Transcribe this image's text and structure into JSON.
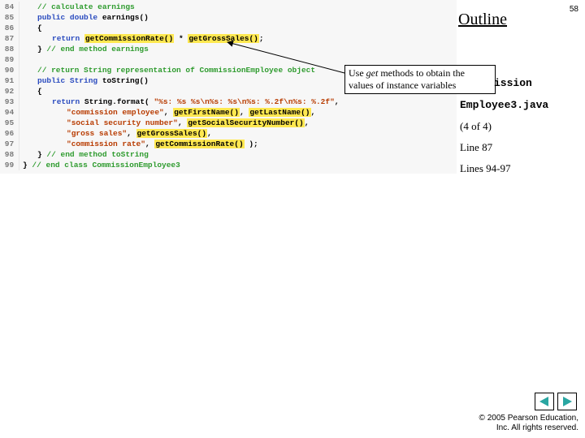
{
  "slide_number": "58",
  "outline_heading": "Outline",
  "callout": {
    "line1_a": "Use ",
    "line1_b_italic": "get",
    "line1_c": " methods to obtain the",
    "line2": "values of instance variables"
  },
  "side": {
    "commission_frag": "ission",
    "employee3": "Employee3.java",
    "page_count": "(4 of 4)",
    "line87": "Line 87",
    "lines9497": "Lines 94-97"
  },
  "footer": {
    "line1": "© 2005 Pearson Education,",
    "line2": "Inc.  All rights reserved."
  },
  "code": {
    "l84": {
      "n": "84",
      "comment": "// calculate earnings"
    },
    "l85": {
      "n": "85",
      "kw1": "public",
      "kw2": "double",
      "name": " earnings()"
    },
    "l86": {
      "n": "86",
      "brace": "{"
    },
    "l87": {
      "n": "87",
      "kw": "return",
      "call1": "getCommissionRate()",
      "op": " * ",
      "call2": "getGrossSales()",
      "semi": ";"
    },
    "l88": {
      "n": "88",
      "brace": "}",
      "comment": " // end method earnings"
    },
    "l89": {
      "n": "89"
    },
    "l90": {
      "n": "90",
      "comment": "// return String representation of CommissionEmployee object"
    },
    "l91": {
      "n": "91",
      "kw1": "public",
      "type": "String",
      "name": " toString()"
    },
    "l92": {
      "n": "92",
      "brace": "{"
    },
    "l93": {
      "n": "93",
      "kw": "return",
      "cls": " String.format( ",
      "str": "\"%s: %s %s\\n%s: %s\\n%s: %.2f\\n%s: %.2f\"",
      "comma": ","
    },
    "l94": {
      "n": "94",
      "str": "\"commission employee\"",
      "c1": ", ",
      "h1": "getFirstName()",
      "c2": ", ",
      "h2": "getLastName()",
      "c3": ","
    },
    "l95": {
      "n": "95",
      "str": "\"social security number\"",
      "c1": ", ",
      "h1": "getSocialSecurityNumber()",
      "c2": ","
    },
    "l96": {
      "n": "96",
      "str": "\"gross sales\"",
      "c1": ", ",
      "h1": "getGrossSales()",
      "c2": ","
    },
    "l97": {
      "n": "97",
      "str": "\"commission rate\"",
      "c1": ", ",
      "h1": "getCommissionRate()",
      "c2": " );"
    },
    "l98": {
      "n": "98",
      "brace": "}",
      "comment": " // end method toString"
    },
    "l99": {
      "n": "99",
      "brace": "}",
      "comment": " // end class CommissionEmployee3"
    }
  }
}
